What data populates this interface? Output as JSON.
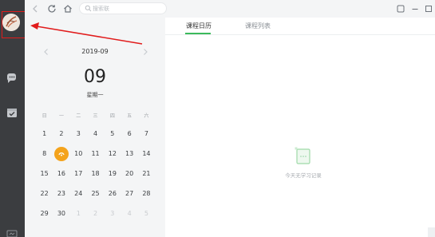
{
  "topbar": {
    "search_placeholder": "搜索联"
  },
  "calendar": {
    "month": "2019-09",
    "big_day": "09",
    "weekday": "星期一",
    "days_of_week": [
      "日",
      "一",
      "二",
      "三",
      "四",
      "五",
      "六"
    ],
    "weeks": [
      [
        "1",
        "2",
        "3",
        "4",
        "5",
        "6",
        "7"
      ],
      [
        "8",
        "",
        "10",
        "11",
        "12",
        "13",
        "14"
      ],
      [
        "15",
        "16",
        "17",
        "18",
        "19",
        "20",
        "21"
      ],
      [
        "22",
        "23",
        "24",
        "25",
        "26",
        "27",
        "28"
      ],
      [
        "29",
        "30",
        "1",
        "2",
        "3",
        "4",
        "5"
      ]
    ]
  },
  "tabs": [
    {
      "label": "课程日历"
    },
    {
      "label": "课程列表"
    }
  ],
  "empty_state": {
    "text": "今天无学习记录"
  },
  "colors": {
    "accent_green": "#3cba5c",
    "today_orange": "#f4a31c",
    "annotation_red": "#e11c1c",
    "rail_bg": "#3b3d40"
  }
}
